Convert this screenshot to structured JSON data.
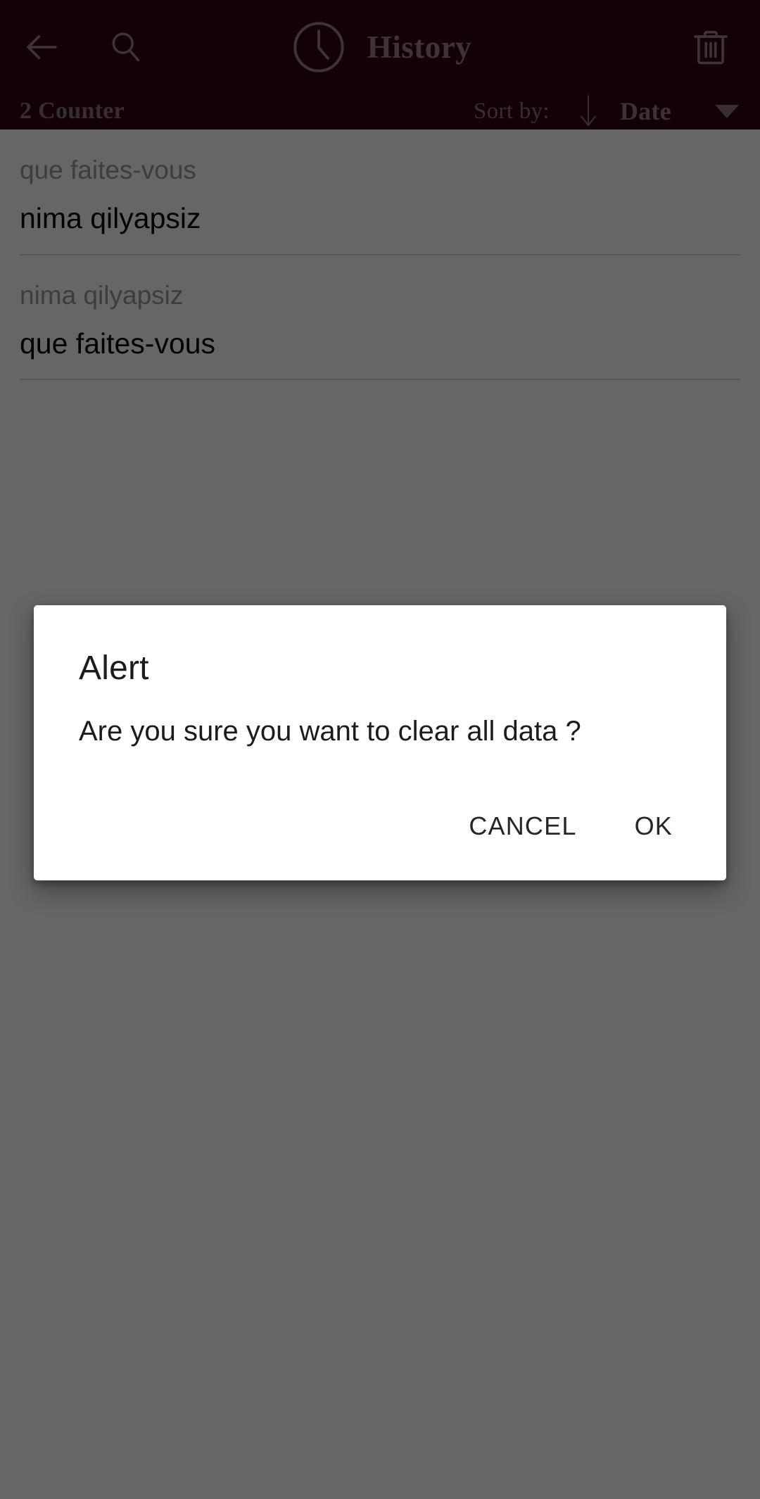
{
  "appbar": {
    "back_icon": "back-arrow-icon",
    "search_icon": "search-icon",
    "clock_icon": "clock-icon",
    "title": "History",
    "delete_icon": "trash-icon"
  },
  "sortbar": {
    "counter": "2 Counter",
    "sort_by_label": "Sort by:",
    "sort_direction_icon": "arrow-down-icon",
    "sort_field": "Date",
    "caret_icon": "chevron-down-icon"
  },
  "history": {
    "items": [
      {
        "source": "que faites-vous",
        "target": "nima qilyapsiz"
      },
      {
        "source": "nima qilyapsiz",
        "target": "que faites-vous"
      }
    ]
  },
  "dialog": {
    "title": "Alert",
    "message": "Are you sure you want to clear all data ?",
    "cancel_label": "CANCEL",
    "ok_label": "OK"
  },
  "colors": {
    "appbar_background": "#2d0614",
    "appbar_foreground": "#9e7f88",
    "list_background": "#ffffff",
    "source_text": "#9a9a9a",
    "target_text": "#000000",
    "dialog_background": "#ffffff",
    "dialog_text": "#1c1c1c",
    "scrim": "rgba(0,0,0,0.60)"
  }
}
